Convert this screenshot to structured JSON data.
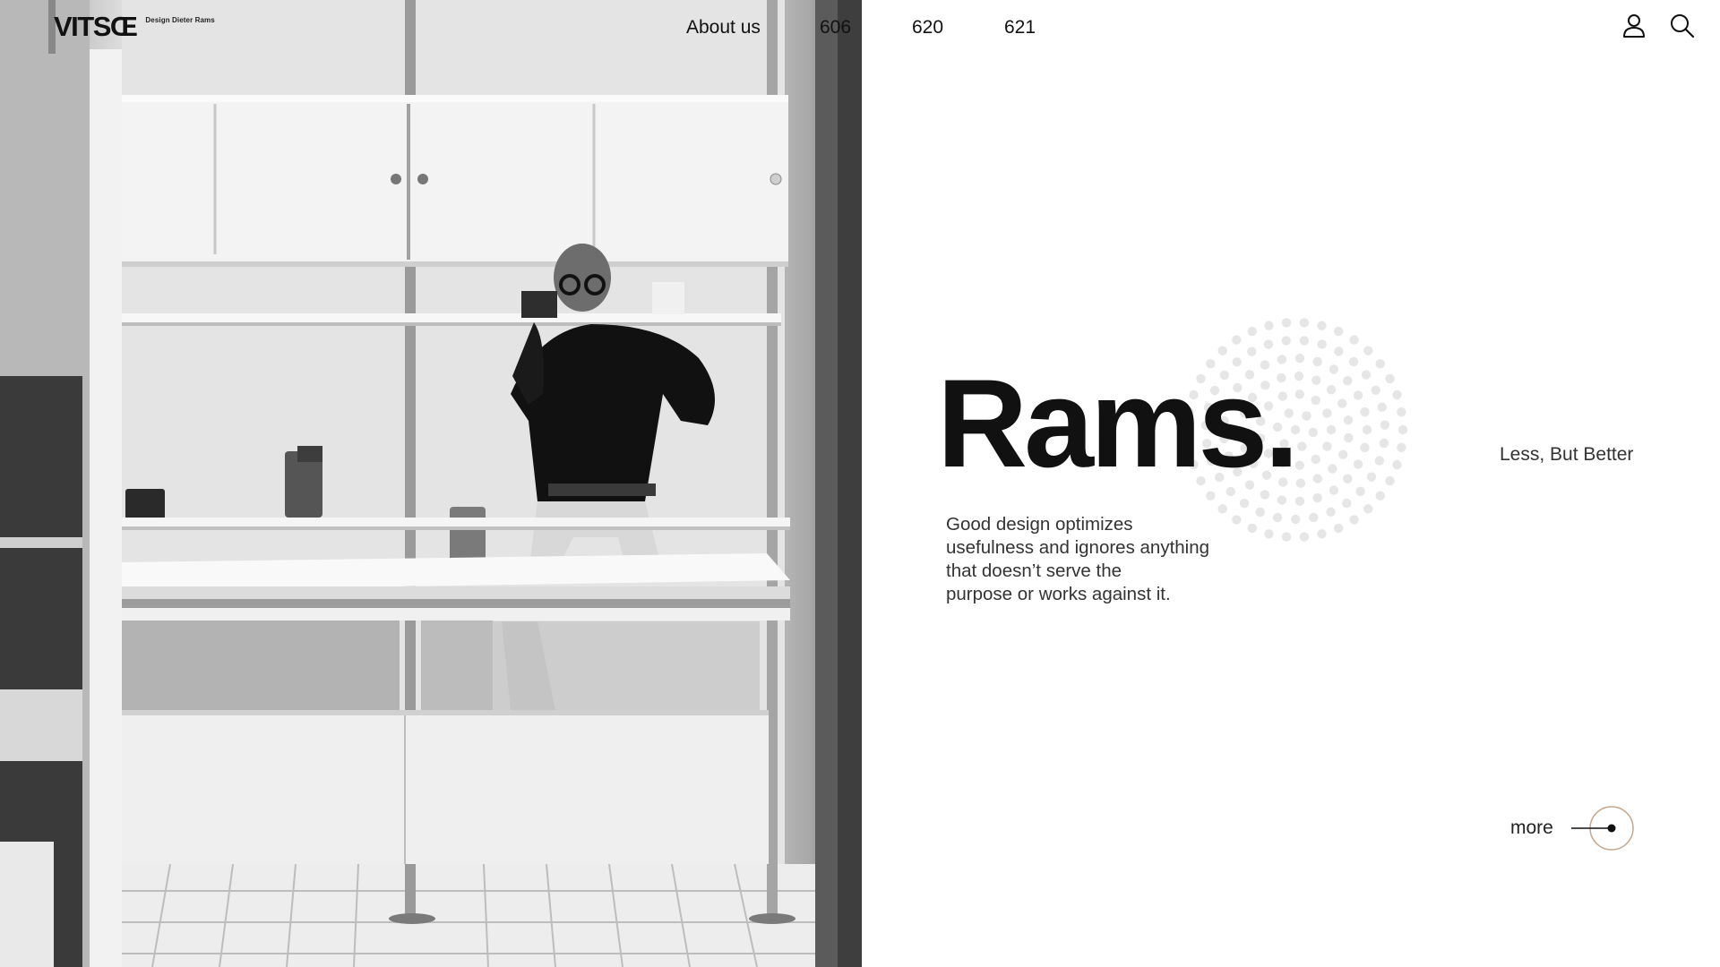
{
  "brand": {
    "logo_text": "VITSŒ",
    "logo_subtitle": "Design Dieter Rams"
  },
  "nav": {
    "items": [
      {
        "label": "About us"
      },
      {
        "label": "606"
      },
      {
        "label": "620"
      },
      {
        "label": "621"
      }
    ]
  },
  "header_icons": [
    "user-icon",
    "search-icon"
  ],
  "hero": {
    "headline": "Rams.",
    "tagline": "Less, But Better",
    "body_lines": [
      "Good design optimizes",
      "usefulness and ignores anything",
      "that doesn’t serve the",
      "purpose or works against it."
    ],
    "more_label": "more"
  },
  "colors": {
    "accent_ring": "#c8a58a",
    "text_dark": "#111111",
    "dot_pattern": "#e6e6e6"
  }
}
